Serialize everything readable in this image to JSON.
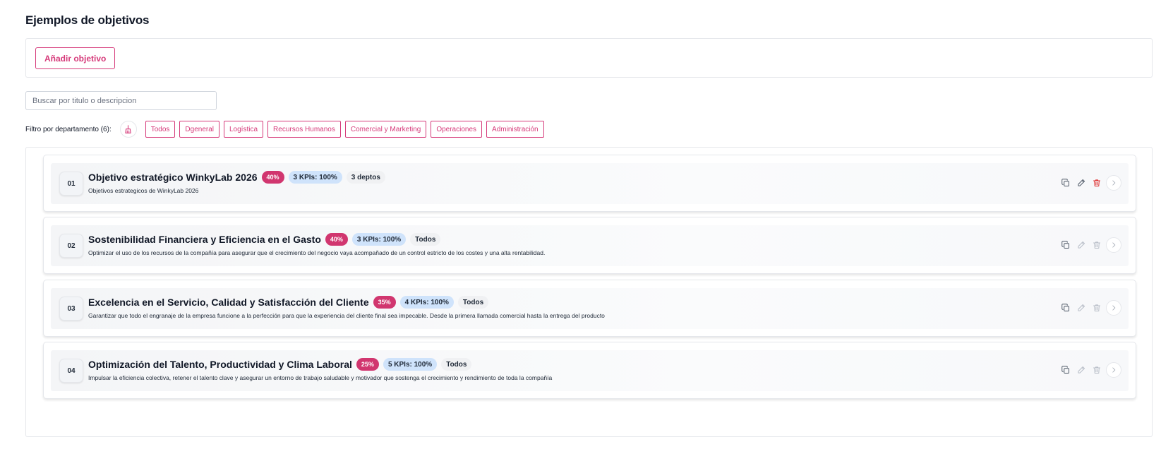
{
  "page": {
    "title": "Ejemplos de objetivos"
  },
  "toolbar": {
    "add_label": "Añadir objetivo"
  },
  "search": {
    "placeholder": "Buscar por titulo o descripcion",
    "value": ""
  },
  "filter": {
    "label": "Filtro por departamento (6):",
    "clear_icon": "broom-icon",
    "chips": [
      "Todos",
      "Dgeneral",
      "Logística",
      "Recursos Humanos",
      "Comercial y Marketing",
      "Operaciones",
      "Administración"
    ]
  },
  "colors": {
    "accent": "#d63a7a",
    "pct_badge": "#d1366f",
    "kpi_badge": "#cfe3fb",
    "delete_active": "#dc2626",
    "icon": "#4b5563",
    "icon_disabled": "#b6bcc6"
  },
  "objectives": [
    {
      "number": "01",
      "title": "Objetivo estratégico WinkyLab 2026",
      "percent": "40%",
      "kpis": "3 KPIs: 100%",
      "departments": "3 deptos",
      "description": "Objetivos estrategicos de WinkyLab 2026",
      "actions": [
        "copy-icon",
        "edit-icon",
        "trash-icon",
        "chevron-right-icon"
      ],
      "editable": true
    },
    {
      "number": "02",
      "title": "Sostenibilidad Financiera y Eficiencia en el Gasto",
      "percent": "40%",
      "kpis": "3 KPIs: 100%",
      "departments": "Todos",
      "description": "Optimizar el uso de los recursos de la compañía para asegurar que el crecimiento del negocio vaya acompañado de un control estricto de los costes y una alta rentabilidad.",
      "actions": [
        "copy-icon",
        "edit-icon",
        "trash-icon",
        "chevron-right-icon"
      ],
      "editable": false
    },
    {
      "number": "03",
      "title": "Excelencia en el Servicio, Calidad y Satisfacción del Cliente",
      "percent": "35%",
      "kpis": "4 KPIs: 100%",
      "departments": "Todos",
      "description": "Garantizar que todo el engranaje de la empresa funcione a la perfección para que la experiencia del cliente final sea impecable. Desde la primera llamada comercial hasta la entrega del producto",
      "actions": [
        "copy-icon",
        "edit-icon",
        "trash-icon",
        "chevron-right-icon"
      ],
      "editable": false
    },
    {
      "number": "04",
      "title": "Optimización del Talento, Productividad y Clima Laboral",
      "percent": "25%",
      "kpis": "5 KPIs: 100%",
      "departments": "Todos",
      "description": "Impulsar la eficiencia colectiva, retener el talento clave y asegurar un entorno de trabajo saludable y motivador que sostenga el crecimiento y rendimiento de toda la compañía",
      "actions": [
        "copy-icon",
        "edit-icon",
        "trash-icon",
        "chevron-right-icon"
      ],
      "editable": false
    }
  ]
}
